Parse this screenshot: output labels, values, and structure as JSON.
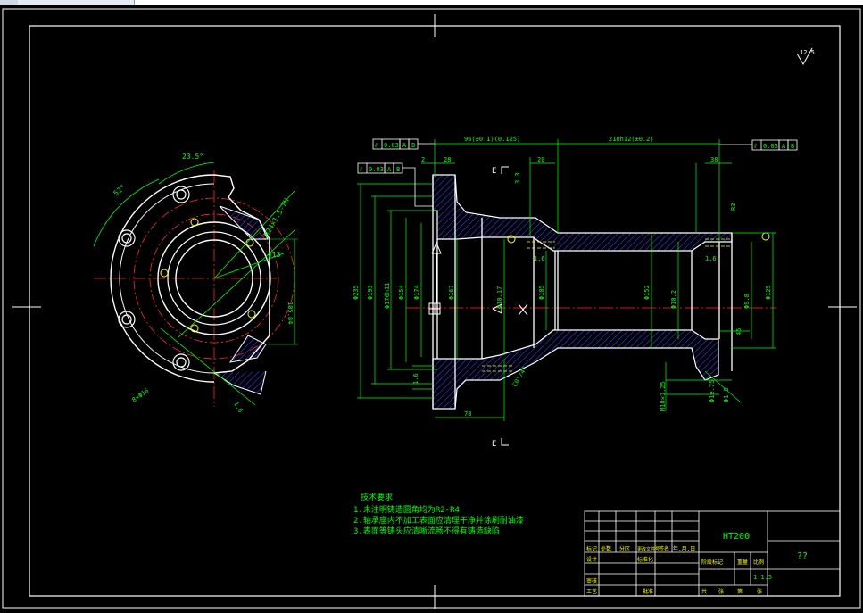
{
  "colors": {
    "background": "#000000",
    "frame": "#ffffff",
    "outline": "#ffffff",
    "dimension": "#00ff00",
    "centerline": "#ff2a2a",
    "hatch": "#3c3cff",
    "annotation": "#ffff00",
    "hidden": "#ffff00"
  },
  "toolbar": {
    "tabs": [
      "",
      ""
    ]
  },
  "surface_mark": "12.5",
  "section_marks": {
    "top": "E",
    "bottom": "E"
  },
  "tolerance_frames": [
    {
      "symbol": "⫽",
      "value": "0.03",
      "datum1": "A",
      "datum2": "B"
    },
    {
      "symbol": "⫽",
      "value": "0.03",
      "datum1": "A",
      "datum2": "B"
    },
    {
      "symbol": "⫽",
      "value": "0.05",
      "datum1": "A",
      "datum2": "B"
    }
  ],
  "dimensions": {
    "top_left_length": "96(±0.1)(0.125)",
    "top_right_length": "218h12(±0.2)",
    "d_28": "28",
    "d_2": "2",
    "d_20": "20",
    "d_38": "38",
    "d_78": "78",
    "d_33": "3.3",
    "d_r3": "R3",
    "d_235": "Φ235",
    "d_193": "Φ193",
    "d_176h": "Φ176h11",
    "d_154": "Φ154",
    "d_174": "Φ174",
    "d_167": "Φ167",
    "d_105": "Φ105",
    "d_152": "Φ152",
    "d_125": "Φ125",
    "d_10x": "Φ10.17",
    "d_22": "22",
    "d_45": "45",
    "d_65": "65",
    "d_r45": "45",
    "d_d6": "1.6",
    "d_25": "25",
    "d_deg1": "23.5°",
    "d_deg2": "52°",
    "d_m12": "Φ13",
    "d_10h": "Φ1e.75",
    "d_4": "1:4",
    "d_side1": "1.6",
    "d_side2": "1.6",
    "d_side3": "Φ1.5",
    "d_m22": "M10×1.25",
    "d_pcd": "8×Φ16",
    "d_angle": "1.6",
    "d_side_vert": "M24×1.5-7H",
    "d_1058": "105.84",
    "d_10_2": "Φ10.2",
    "d_9_8": "Φ9.8",
    "d_deg4": "C0°/4°"
  },
  "notes": {
    "heading": "技术要求",
    "lines": [
      "1.未注明铸造圆角均为R2-R4",
      "2.轴承座内不加工表面应清理干净并涂刷耐油漆",
      "3.表面等铸头应清晰流畅不得有铸造缺陷"
    ]
  },
  "title_block": {
    "material": "HT200",
    "drawing_no": "??",
    "scale_label": "比例",
    "scale": "1:1.5",
    "row_labels": [
      "标记",
      "处数",
      "分区",
      "更改文件号",
      "签名",
      "年.月.日"
    ],
    "left_labels": [
      "设计",
      "审核",
      "工艺"
    ],
    "middle_labels": [
      "标准化",
      "批准"
    ],
    "right_labels": [
      "阶段标记",
      "重量",
      "比例"
    ],
    "bottom_labels": [
      "共",
      "张",
      "第",
      "张"
    ]
  }
}
